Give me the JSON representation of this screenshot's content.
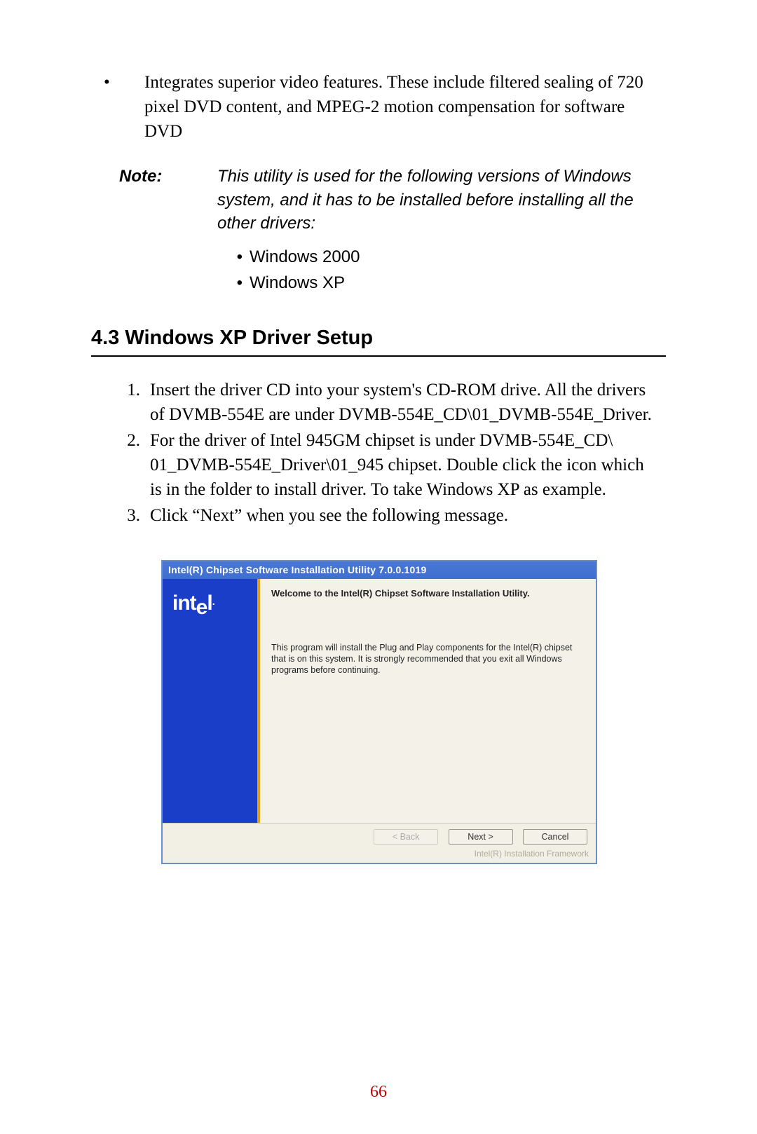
{
  "bullet1": {
    "marker": "•",
    "text": "Integrates superior video features. These include filtered sealing of 720 pixel DVD content, and MPEG-2 motion compensation for software DVD"
  },
  "note": {
    "label": "Note:",
    "text": "This utility is used for the following versions of Windows system, and it has to be installed before installing all the other drivers:",
    "items": [
      {
        "marker": "•",
        "text": "Windows 2000"
      },
      {
        "marker": "•",
        "text": "Windows XP"
      }
    ]
  },
  "section_heading": "4.3  Windows XP Driver Setup",
  "steps": [
    {
      "num": "1.",
      "text": "Insert the driver CD into your system's CD-ROM drive. All the drivers of DVMB-554E are under DVMB-554E_CD\\01_DVMB-554E_Driver."
    },
    {
      "num": "2.",
      "text": "For the driver of Intel 945GM chipset is under DVMB-554E_CD\\ 01_DVMB-554E_Driver\\01_945 chipset. Double click the icon which is in the folder to install driver. To take Windows XP as example."
    },
    {
      "num": "3.",
      "text": " Click “Next” when you see the following message."
    }
  ],
  "installer": {
    "titlebar": "Intel(R) Chipset Software Installation Utility 7.0.0.1019",
    "logo_text_parts": {
      "pre": "int",
      "drop": "e",
      "post": "l"
    },
    "logo_dot": ".",
    "welcome_title": "Welcome to the Intel(R) Chipset Software Installation Utility.",
    "welcome_desc": "This program will install the Plug and Play components for the Intel(R) chipset that is on this system. It is strongly recommended that you exit all Windows programs before continuing.",
    "buttons": {
      "back": "< Back",
      "next": "Next >",
      "cancel": "Cancel"
    },
    "footer": "Intel(R) Installation Framework"
  },
  "page_number": "66"
}
